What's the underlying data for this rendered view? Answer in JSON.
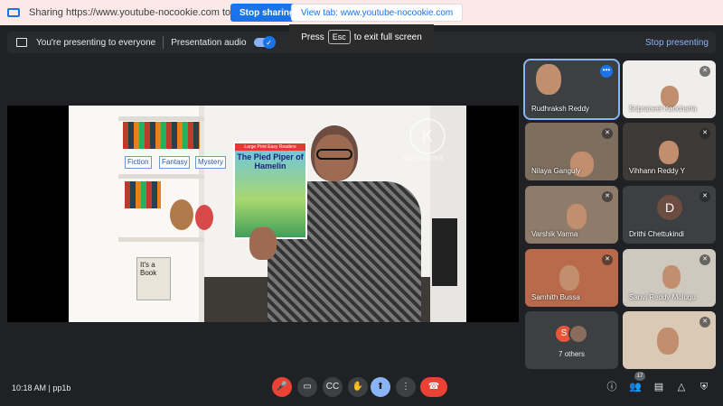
{
  "sharing_bar": {
    "text": "Sharing https://www.youtube-nocookie.com to meet.google.com",
    "stop_sharing_label": "Stop sharing",
    "view_tab_label": "View tab: www.youtube-nocookie.com"
  },
  "esc_overlay": {
    "prefix": "Press",
    "key": "Esc",
    "suffix": "to exit full screen"
  },
  "present_bar": {
    "presenting_text": "You're presenting to everyone",
    "audio_label": "Presentation audio",
    "audio_on": true,
    "stop_presenting_label": "Stop presenting"
  },
  "main_video": {
    "shelf_labels": [
      "Fiction",
      "Fantasy",
      "Mystery"
    ],
    "shelf_book_title": "It's a Book",
    "held_book_series": "Large Print Easy Readers",
    "held_book_title": "The Pied Piper of Hamelin",
    "watermark_text": "SAVEPASTER"
  },
  "participants": [
    {
      "name": "Rudhraksh Reddy",
      "status": "more",
      "active": true
    },
    {
      "name": "Sripraneel Kancharla",
      "status": "muted"
    },
    {
      "name": "Nilaya Ganguly",
      "status": "muted"
    },
    {
      "name": "Vihhann Reddy Y",
      "status": "muted"
    },
    {
      "name": "Varshik Varma",
      "status": "muted"
    },
    {
      "name": "Drithi Chettukindi",
      "status": "muted",
      "initial": "D"
    },
    {
      "name": "Samhith Bussa",
      "status": "muted"
    },
    {
      "name": "Sanvi Reddy Molugu",
      "status": "muted"
    },
    {
      "name": "7 others",
      "initial": "S"
    },
    {
      "name": "",
      "status": "muted"
    }
  ],
  "bottom_bar": {
    "time": "10:18 AM",
    "meeting_code": "pp1b",
    "participant_count": "17"
  },
  "icons": {
    "mic_off": "mic-off-icon",
    "camera": "camera-icon",
    "captions": "captions-icon",
    "raise_hand": "hand-icon",
    "present": "present-icon",
    "more": "more-vert-icon",
    "hangup": "hangup-icon",
    "info": "info-icon",
    "people": "people-icon",
    "chat": "chat-icon",
    "activities": "activities-icon",
    "host_controls": "shield-icon"
  },
  "colors": {
    "accent": "#1a73e8",
    "danger": "#ea4335",
    "active_tile": "#8ab4f8"
  }
}
